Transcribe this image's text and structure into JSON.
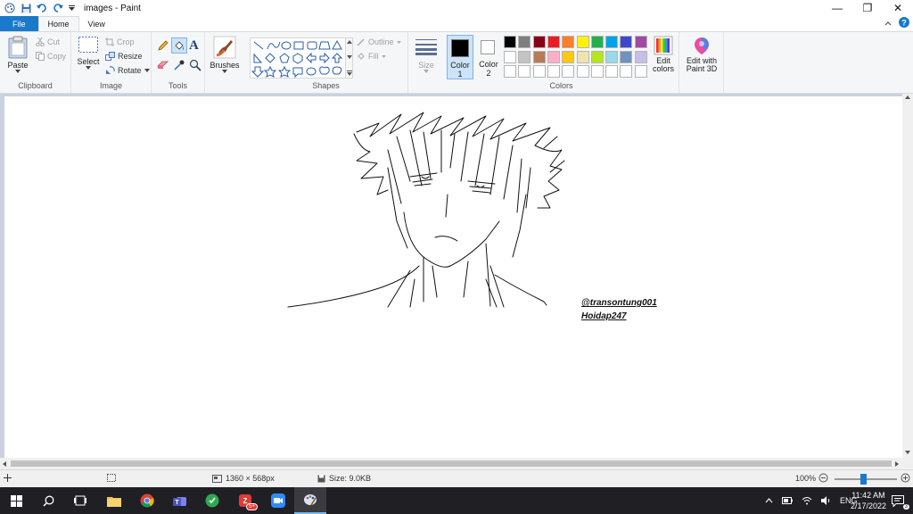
{
  "window": {
    "title": "images - Paint",
    "controls": {
      "minimize": "—",
      "maximize": "❐",
      "close": "✕"
    }
  },
  "tabs": [
    {
      "label": "File"
    },
    {
      "label": "Home"
    },
    {
      "label": "View"
    }
  ],
  "ribbon": {
    "clipboard": {
      "paste": "Paste",
      "cut": "Cut",
      "copy": "Copy",
      "group": "Clipboard"
    },
    "image": {
      "select": "Select",
      "crop": "Crop",
      "resize": "Resize",
      "rotate": "Rotate",
      "group": "Image"
    },
    "tools": {
      "group": "Tools"
    },
    "brushes": {
      "label": "Brushes"
    },
    "shapes": {
      "outline": "Outline",
      "fill": "Fill",
      "group": "Shapes"
    },
    "size": {
      "label": "Size"
    },
    "color1": {
      "label": "Color",
      "num": "1"
    },
    "color2": {
      "label": "Color",
      "num": "2"
    },
    "colors": {
      "group": "Colors",
      "row1": [
        "#000000",
        "#7f7f7f",
        "#880015",
        "#ed1c24",
        "#ff7f27",
        "#fff200",
        "#22b14c",
        "#00a2e8",
        "#3f48cc",
        "#a349a4"
      ],
      "row2": [
        "#ffffff",
        "#c3c3c3",
        "#b97a57",
        "#ffaec9",
        "#ffc90e",
        "#efe4b0",
        "#b5e61d",
        "#99d9ea",
        "#7092be",
        "#c8bfe7"
      ],
      "row3": [
        "#ffffff",
        "#ffffff",
        "#ffffff",
        "#ffffff",
        "#ffffff",
        "#ffffff",
        "#ffffff",
        "#ffffff",
        "#ffffff",
        "#ffffff"
      ]
    },
    "edit_colors": {
      "line1": "Edit",
      "line2": "colors"
    },
    "paint3d": {
      "line1": "Edit with",
      "line2": "Paint 3D"
    }
  },
  "canvas": {
    "signature_line1": "@transontung001",
    "signature_line2": "Hoidap247"
  },
  "statusbar": {
    "dimensions": "1360 × 568px",
    "size": "Size: 9.0KB",
    "zoom": "100%"
  },
  "taskbar": {
    "language": "ENG",
    "time": "11:42 AM",
    "date": "2/17/2022",
    "notification_count": "3",
    "zalo_badge": "5+"
  },
  "colors": {
    "file_tab": "#1979ca",
    "ribbon_bg": "#f5f6f7",
    "canvas_bg": "#c9d2de",
    "taskbar_bg": "#1f1f24"
  }
}
